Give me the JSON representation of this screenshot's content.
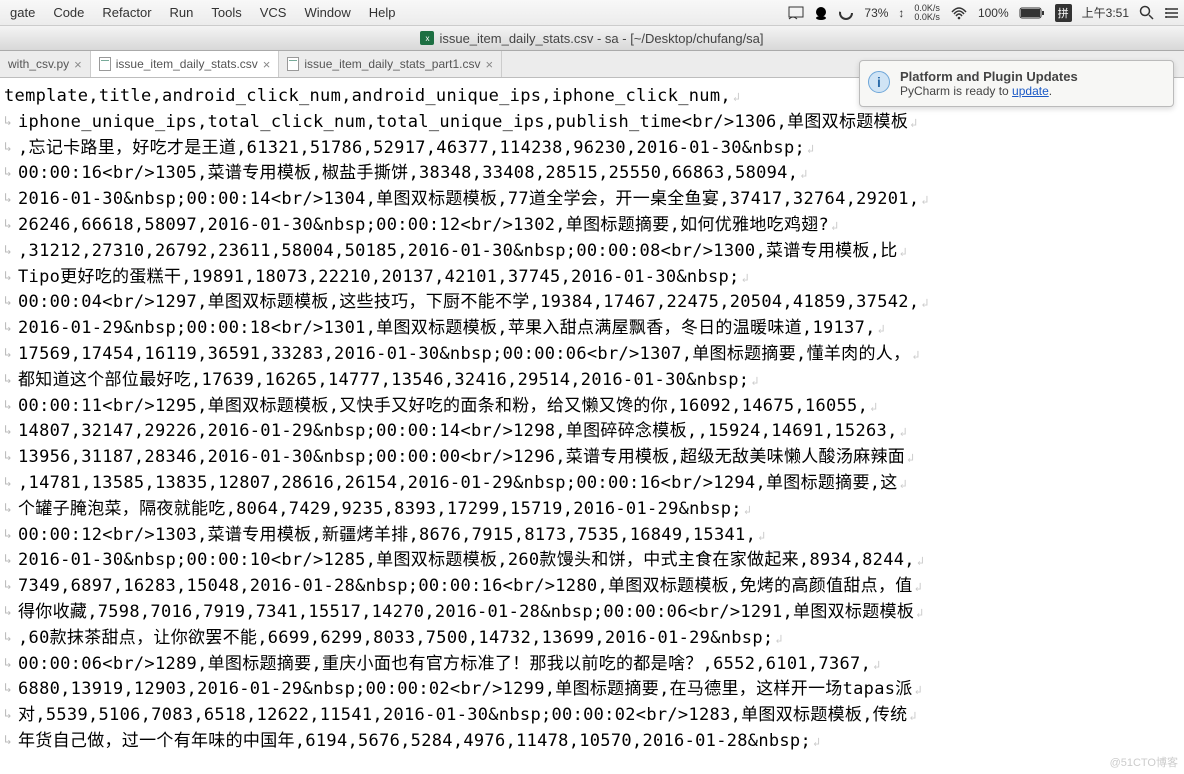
{
  "menubar": {
    "items": [
      "gate",
      "Code",
      "Refactor",
      "Run",
      "Tools",
      "VCS",
      "Window",
      "Help"
    ],
    "battery": "73%",
    "speed_up": "0.0K/s",
    "speed_down": "0.0K/s",
    "wifi_pct": "100%",
    "ime": "拼",
    "time": "上午3:51"
  },
  "window_title": "issue_item_daily_stats.csv - sa - [~/Desktop/chufang/sa]",
  "tabs": [
    {
      "label": "with_csv.py",
      "active": false
    },
    {
      "label": "issue_item_daily_stats.csv",
      "active": true
    },
    {
      "label": "issue_item_daily_stats_part1.csv",
      "active": false
    }
  ],
  "notification": {
    "title": "Platform and Plugin Updates",
    "prefix": "PyCharm is ready to ",
    "link": "update",
    "suffix": "."
  },
  "watermark": "@51CTO博客",
  "editor_lines": [
    {
      "c": false,
      "t": "template,title,android_click_num,android_unique_ips,iphone_click_num,"
    },
    {
      "c": true,
      "t": "iphone_unique_ips,total_click_num,total_unique_ips,publish_time<br/>1306,单图双标题模板"
    },
    {
      "c": true,
      "t": ",忘记卡路里，好吃才是王道,61321,51786,52917,46377,114238,96230,2016-01-30&nbsp;"
    },
    {
      "c": true,
      "t": "00:00:16<br/>1305,菜谱专用模板,椒盐手撕饼,38348,33408,28515,25550,66863,58094,"
    },
    {
      "c": true,
      "t": "2016-01-30&nbsp;00:00:14<br/>1304,单图双标题模板,77道全学会，开一桌全鱼宴,37417,32764,29201,"
    },
    {
      "c": true,
      "t": "26246,66618,58097,2016-01-30&nbsp;00:00:12<br/>1302,单图标题摘要,如何优雅地吃鸡翅?"
    },
    {
      "c": true,
      "t": ",31212,27310,26792,23611,58004,50185,2016-01-30&nbsp;00:00:08<br/>1300,菜谱专用模板,比"
    },
    {
      "c": true,
      "t": "Tipo更好吃的蛋糕干,19891,18073,22210,20137,42101,37745,2016-01-30&nbsp;"
    },
    {
      "c": true,
      "t": "00:00:04<br/>1297,单图双标题模板,这些技巧，下厨不能不学,19384,17467,22475,20504,41859,37542,"
    },
    {
      "c": true,
      "t": "2016-01-29&nbsp;00:00:18<br/>1301,单图双标题模板,苹果入甜点满屋飘香，冬日的温暖味道,19137,"
    },
    {
      "c": true,
      "t": "17569,17454,16119,36591,33283,2016-01-30&nbsp;00:00:06<br/>1307,单图标题摘要,懂羊肉的人，"
    },
    {
      "c": true,
      "t": "都知道这个部位最好吃,17639,16265,14777,13546,32416,29514,2016-01-30&nbsp;"
    },
    {
      "c": true,
      "t": "00:00:11<br/>1295,单图双标题模板,又快手又好吃的面条和粉，给又懒又馋的你,16092,14675,16055,"
    },
    {
      "c": true,
      "t": "14807,32147,29226,2016-01-29&nbsp;00:00:14<br/>1298,单图碎碎念模板,,15924,14691,15263,"
    },
    {
      "c": true,
      "t": "13956,31187,28346,2016-01-30&nbsp;00:00:00<br/>1296,菜谱专用模板,超级无敌美味懒人酸汤麻辣面"
    },
    {
      "c": true,
      "t": ",14781,13585,13835,12807,28616,26154,2016-01-29&nbsp;00:00:16<br/>1294,单图标题摘要,这"
    },
    {
      "c": true,
      "t": "个罐子腌泡菜，隔夜就能吃,8064,7429,9235,8393,17299,15719,2016-01-29&nbsp;"
    },
    {
      "c": true,
      "t": "00:00:12<br/>1303,菜谱专用模板,新疆烤羊排,8676,7915,8173,7535,16849,15341,"
    },
    {
      "c": true,
      "t": "2016-01-30&nbsp;00:00:10<br/>1285,单图双标题模板,260款馒头和饼，中式主食在家做起来,8934,8244,"
    },
    {
      "c": true,
      "t": "7349,6897,16283,15048,2016-01-28&nbsp;00:00:16<br/>1280,单图双标题模板,免烤的高颜值甜点，值"
    },
    {
      "c": true,
      "t": "得你收藏,7598,7016,7919,7341,15517,14270,2016-01-28&nbsp;00:00:06<br/>1291,单图双标题模板"
    },
    {
      "c": true,
      "t": ",60款抹茶甜点，让你欲罢不能,6699,6299,8033,7500,14732,13699,2016-01-29&nbsp;"
    },
    {
      "c": true,
      "t": "00:00:06<br/>1289,单图标题摘要,重庆小面也有官方标准了！那我以前吃的都是啥？,6552,6101,7367,"
    },
    {
      "c": true,
      "t": "6880,13919,12903,2016-01-29&nbsp;00:00:02<br/>1299,单图标题摘要,在马德里，这样开一场tapas派"
    },
    {
      "c": true,
      "t": "对,5539,5106,7083,6518,12622,11541,2016-01-30&nbsp;00:00:02<br/>1283,单图双标题模板,传统"
    },
    {
      "c": true,
      "t": "年货自己做，过一个有年味的中国年,6194,5676,5284,4976,11478,10570,2016-01-28&nbsp;"
    }
  ]
}
